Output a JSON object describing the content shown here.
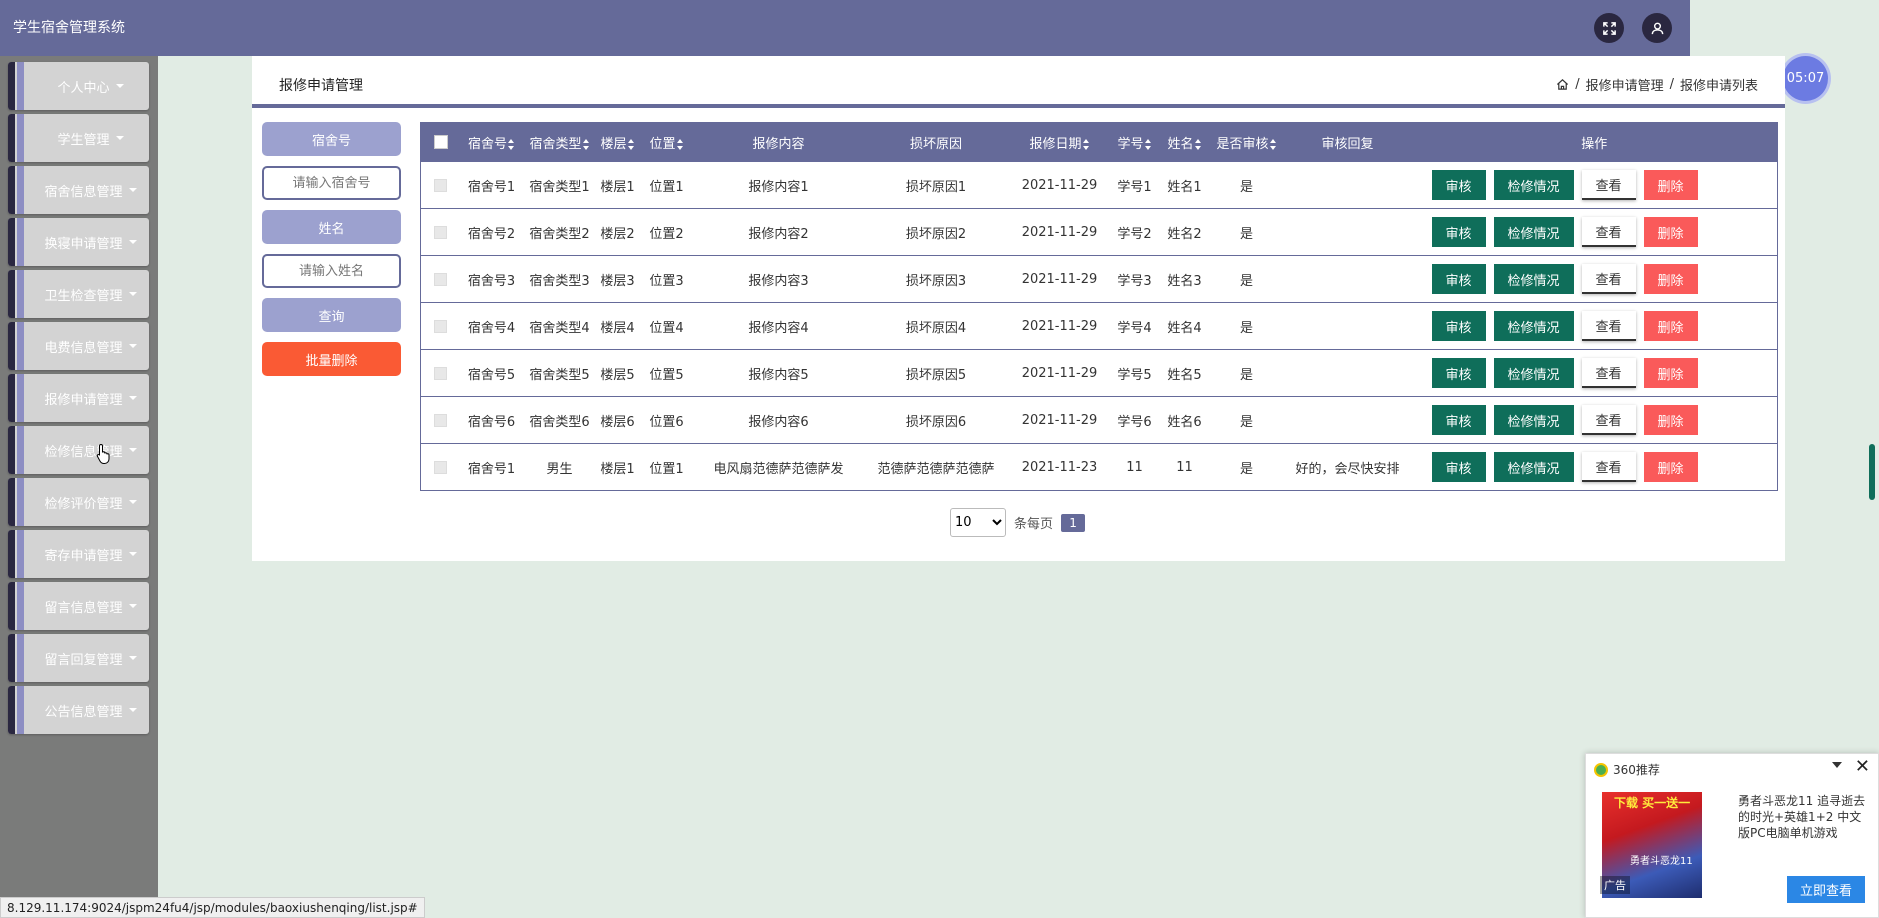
{
  "app": {
    "title": "学生宿舍管理系统"
  },
  "header": {
    "fullscreen_icon": "expand-icon",
    "user_icon": "user-icon"
  },
  "timer": "05:07",
  "sidebar": {
    "items": [
      {
        "label": "个人中心"
      },
      {
        "label": "学生管理"
      },
      {
        "label": "宿舍信息管理"
      },
      {
        "label": "换寝申请管理"
      },
      {
        "label": "卫生检查管理"
      },
      {
        "label": "电费信息管理"
      },
      {
        "label": "报修申请管理"
      },
      {
        "label": "检修信息管理"
      },
      {
        "label": "检修评价管理"
      },
      {
        "label": "寄存申请管理"
      },
      {
        "label": "留言信息管理"
      },
      {
        "label": "留言回复管理"
      },
      {
        "label": "公告信息管理"
      }
    ]
  },
  "page": {
    "title": "报修申请管理",
    "breadcrumb": [
      "报修申请管理",
      "报修申请列表"
    ]
  },
  "search": {
    "dorm_label": "宿舍号",
    "dorm_placeholder": "请输入宿舍号",
    "name_label": "姓名",
    "name_placeholder": "请输入姓名",
    "query_button": "查询",
    "batch_delete_button": "批量删除"
  },
  "table": {
    "headers": [
      "宿舍号",
      "宿舍类型",
      "楼层",
      "位置",
      "报修内容",
      "损坏原因",
      "报修日期",
      "学号",
      "姓名",
      "是否审核",
      "审核回复",
      "操作"
    ],
    "rows": [
      {
        "dorm": "宿舍号1",
        "type": "宿舍类型1",
        "floor": "楼层1",
        "pos": "位置1",
        "content": "报修内容1",
        "reason": "损坏原因1",
        "date": "2021-11-29",
        "sid": "学号1",
        "name": "姓名1",
        "audited": "是",
        "reply": ""
      },
      {
        "dorm": "宿舍号2",
        "type": "宿舍类型2",
        "floor": "楼层2",
        "pos": "位置2",
        "content": "报修内容2",
        "reason": "损坏原因2",
        "date": "2021-11-29",
        "sid": "学号2",
        "name": "姓名2",
        "audited": "是",
        "reply": ""
      },
      {
        "dorm": "宿舍号3",
        "type": "宿舍类型3",
        "floor": "楼层3",
        "pos": "位置3",
        "content": "报修内容3",
        "reason": "损坏原因3",
        "date": "2021-11-29",
        "sid": "学号3",
        "name": "姓名3",
        "audited": "是",
        "reply": ""
      },
      {
        "dorm": "宿舍号4",
        "type": "宿舍类型4",
        "floor": "楼层4",
        "pos": "位置4",
        "content": "报修内容4",
        "reason": "损坏原因4",
        "date": "2021-11-29",
        "sid": "学号4",
        "name": "姓名4",
        "audited": "是",
        "reply": ""
      },
      {
        "dorm": "宿舍号5",
        "type": "宿舍类型5",
        "floor": "楼层5",
        "pos": "位置5",
        "content": "报修内容5",
        "reason": "损坏原因5",
        "date": "2021-11-29",
        "sid": "学号5",
        "name": "姓名5",
        "audited": "是",
        "reply": ""
      },
      {
        "dorm": "宿舍号6",
        "type": "宿舍类型6",
        "floor": "楼层6",
        "pos": "位置6",
        "content": "报修内容6",
        "reason": "损坏原因6",
        "date": "2021-11-29",
        "sid": "学号6",
        "name": "姓名6",
        "audited": "是",
        "reply": ""
      },
      {
        "dorm": "宿舍号1",
        "type": "男生",
        "floor": "楼层1",
        "pos": "位置1",
        "content": "电风扇范德萨范德萨发",
        "reason": "范德萨范德萨范德萨",
        "date": "2021-11-23",
        "sid": "11",
        "name": "11",
        "audited": "是",
        "reply": "好的，会尽快安排"
      }
    ],
    "actions": {
      "audit": "审核",
      "repair": "检修情况",
      "view": "查看",
      "delete": "删除"
    }
  },
  "pager": {
    "page_size": "10",
    "per_page_text": "条每页",
    "current_page": "1"
  },
  "status_bar": "8.129.11.174:9024/jspm24fu4/jsp/modules/baoxiushenqing/list.jsp#",
  "ad": {
    "source": "360推荐",
    "image_top_text": "下载 买一送一",
    "image_mid_text": "勇者斗恶龙11",
    "tag": "广告",
    "text": "勇者斗恶龙11 追寻逝去的时光+英雄1+2 中文版PC电脑单机游戏",
    "button": "立即查看"
  },
  "colors": {
    "primary": "#656a99",
    "success": "#0f6e5a",
    "danger": "#fa5a5a",
    "accent": "#fa5a34"
  }
}
